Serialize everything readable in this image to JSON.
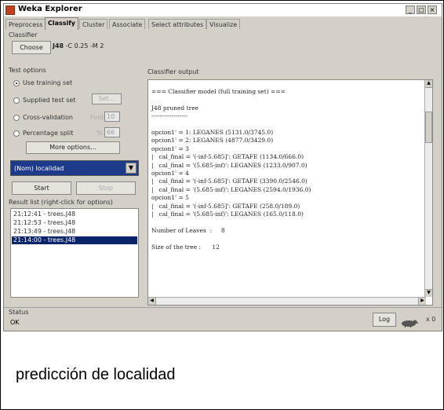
{
  "window": {
    "title": "Weka Explorer"
  },
  "tabs": [
    "Preprocess",
    "Classify",
    "Cluster",
    "Associate",
    "Select attributes",
    "Visualize"
  ],
  "active_tab": 1,
  "classifier": {
    "section_label": "Classifier",
    "choose_label": "Choose",
    "name": "J48",
    "options": "-C 0.25 -M 2"
  },
  "test_options": {
    "section_label": "Test options",
    "use_training_set": "Use training set",
    "supplied_test_set": "Supplied test set",
    "set_button": "Set...",
    "cross_validation": "Cross-validation",
    "folds_label": "Folds",
    "folds_value": "10",
    "percentage_split": "Percentage split",
    "percent_symbol": "%",
    "percent_value": "66",
    "more_options": "More options..."
  },
  "class_attribute": "(Nom) localidad",
  "actions": {
    "start": "Start",
    "stop": "Stop"
  },
  "result_list": {
    "label": "Result list (right-click for options)",
    "items": [
      "21:12:41 - trees.J48",
      "21:12:53 - trees.J48",
      "21:13:49 - trees.J48",
      "21:14:00 - trees.J48"
    ],
    "selected_index": 3
  },
  "output": {
    "label": "Classifier output",
    "lines": [
      "=== Classifier model (full training set) ===",
      "",
      "J48 pruned tree",
      "------------------",
      "",
      "opcion1' = 1: LEGANES (5131.0/3745.0)",
      "opcion1' = 2: LEGANES (4877.0/3429.0)",
      "opcion1' = 3",
      "|   cal_final = '(-inf-5.685]': GETAFE (1134.0/666.0)",
      "|   cal_final = '(5.685-inf)': LEGANES (1233.0/907.0)",
      "opcion1' = 4",
      "|   cal_final = '(-inf-5.685]': GETAFE (3390.0/2546.0)",
      "|   cal_final = '(5.685-inf)': LEGANES (2594.0/1936.0)",
      "opcion1' = 5",
      "|   cal_final = '(-inf-5.685]': GETAFE (258.0/189.0)",
      "|   cal_final = '(5.685-inf)': LEGANES (165.0/118.0)",
      "",
      "Number of Leaves  :     8",
      "",
      "Size of the tree :      12"
    ]
  },
  "status": {
    "label": "Status",
    "text": "OK",
    "log_button": "Log",
    "x_count": "x 0"
  },
  "caption": "predicción de localidad"
}
